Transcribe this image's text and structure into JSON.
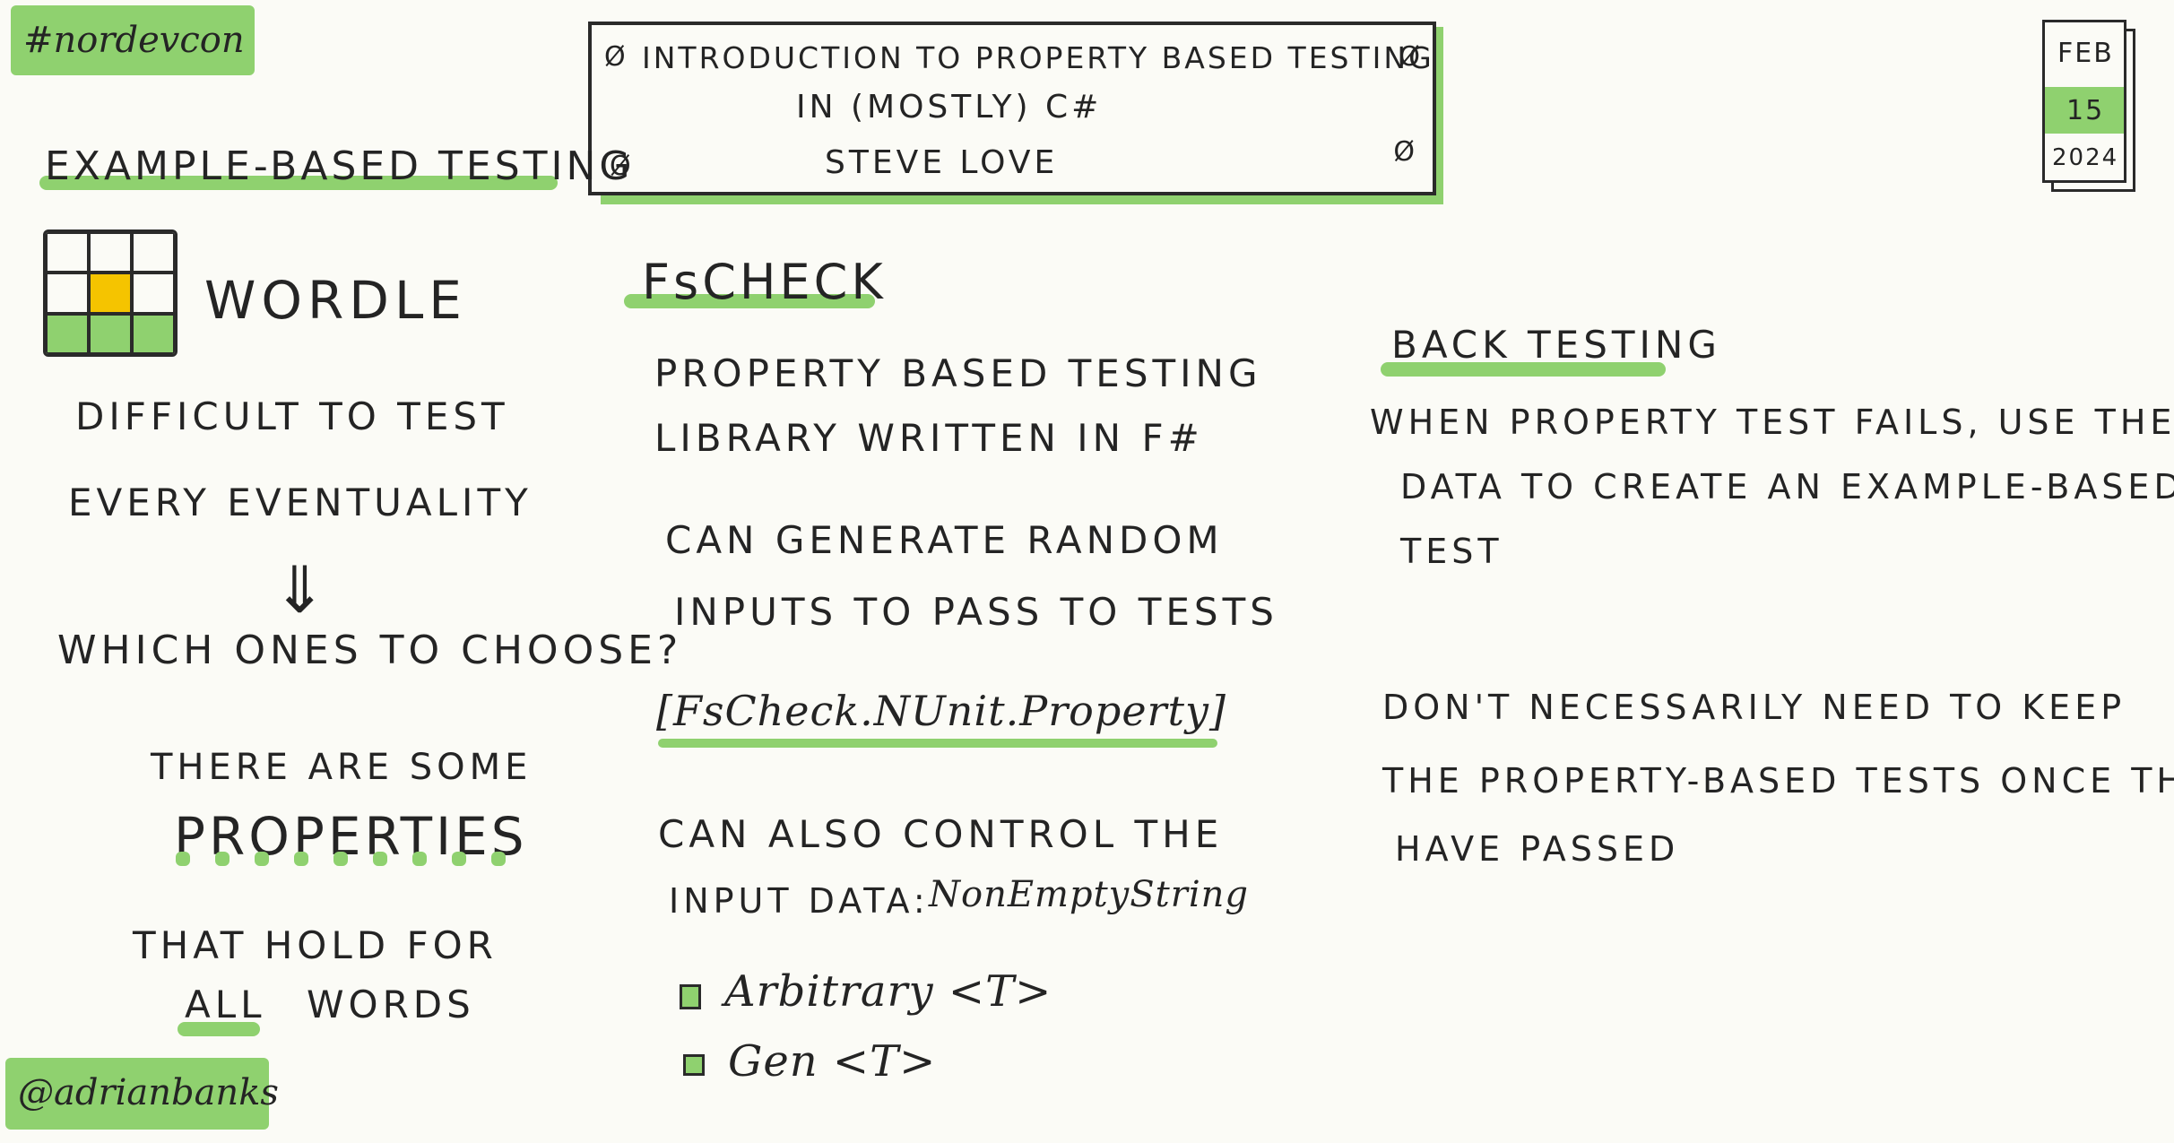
{
  "hashtag": "#nordevcon",
  "author": "@adrianbanks",
  "title": {
    "line1": "INTRODUCTION TO PROPERTY BASED TESTING",
    "line2": "IN (MOSTLY) C#",
    "speaker": "STEVE LOVE",
    "nut_symbol": "Ø"
  },
  "date": {
    "month": "FEB",
    "day": "15",
    "year": "2024"
  },
  "left": {
    "heading": "EXAMPLE-BASED TESTING",
    "wordle_label": "WORDLE",
    "difficult_line1": "DIFFICULT TO TEST",
    "difficult_line2": "EVERY EVENTUALITY",
    "arrow": "⇓",
    "which": "WHICH ONES TO CHOOSE?",
    "there_are": "THERE ARE SOME",
    "properties": "PROPERTIES",
    "that_hold": "THAT HOLD FOR",
    "all": "ALL",
    "words": "WORDS"
  },
  "middle": {
    "heading": "FsCHECK",
    "desc_line1": "PROPERTY BASED TESTING",
    "desc_line2": "LIBRARY WRITTEN IN F#",
    "gen_line1": "CAN GENERATE RANDOM",
    "gen_line2": "INPUTS TO PASS TO TESTS",
    "attribute": "[FsCheck.NUnit.Property]",
    "control_line1": "CAN ALSO CONTROL THE",
    "control_line2": "INPUT DATA:",
    "control_value": "NonEmptyString",
    "bullets": [
      "Arbitrary <T>",
      "Gen <T>"
    ]
  },
  "right": {
    "heading": "BACK TESTING",
    "when_line1": "WHEN PROPERTY TEST FAILS, USE THE",
    "when_line2": "DATA TO CREATE AN EXAMPLE-BASED",
    "when_line3": "TEST",
    "dont_line1": "DON'T NECESSARILY NEED TO KEEP",
    "dont_line2": "THE PROPERTY-BASED TESTS ONCE THEY",
    "dont_line3": "HAVE PASSED"
  },
  "colors": {
    "highlight": "#8fd16f",
    "wordle_yellow": "#f5c400",
    "ink": "#242424"
  }
}
